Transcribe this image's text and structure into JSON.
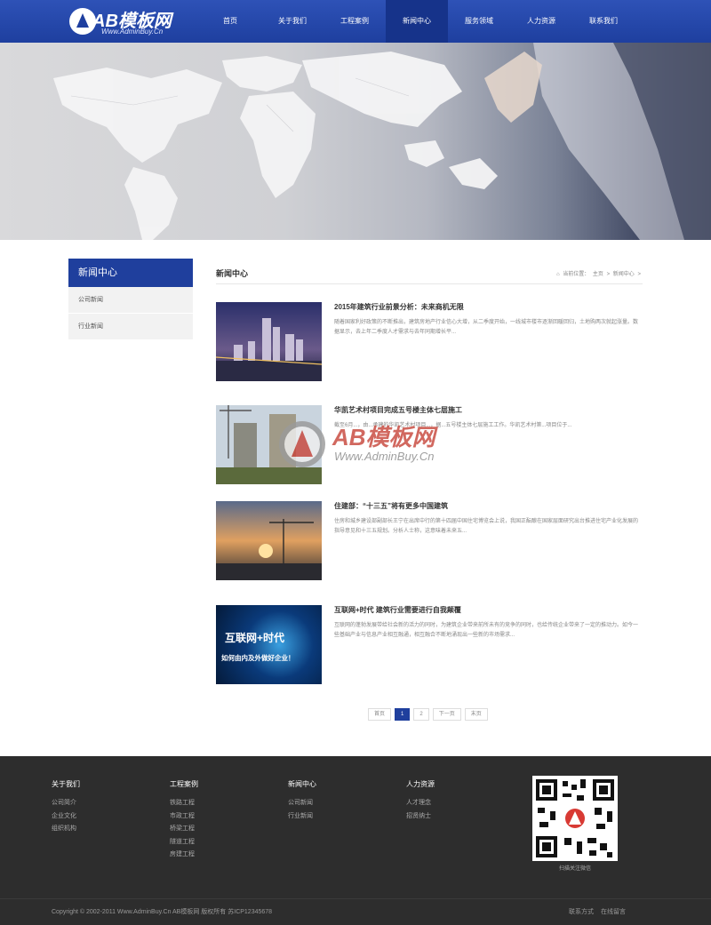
{
  "header": {
    "logo_text": "AB模板网",
    "logo_url": "Www.AdminBuy.Cn",
    "nav": [
      {
        "label": "首页"
      },
      {
        "label": "关于我们"
      },
      {
        "label": "工程案例"
      },
      {
        "label": "新闻中心",
        "active": true
      },
      {
        "label": "服务领域"
      },
      {
        "label": "人力资源"
      },
      {
        "label": "联系我们"
      }
    ]
  },
  "sidebar": {
    "title": "新闻中心",
    "items": [
      {
        "label": "公司新闻"
      },
      {
        "label": "行业新闻"
      }
    ]
  },
  "main": {
    "title": "新闻中心",
    "breadcrumb": {
      "prefix": "当前位置：",
      "home": "主页",
      "sep": ">",
      "current": "新闻中心",
      "end": ">"
    },
    "news": [
      {
        "title": "2015年建筑行业前景分析：未来商机无限",
        "desc": "随着国家利好政策的不断推出，建筑房地产行业信心大增，从二季度开始，一线城市楼市逐渐回暖回归，土地购两次就起涨量。数据显示，去上年二季度人才需求与去年同期增长平..."
      },
      {
        "title": "华凯艺术村项目完成五号楼主体七层施工",
        "desc": "截至6月...，由...承建的华凯艺术村项目...，据...五号楼主体七层施工工作。华凯艺术村第...项目位于..."
      },
      {
        "title": "住建部：“十三五”将有更多中国建筑",
        "desc": "住房和城乡建设部副部长王宁在出席中行的第十四届中国住宅博览会上说，我国正酝酿在国家层面研究出台推进住宅产业化发展的指导意见和十三五规划。分析人士称，这意味着未来五..."
      },
      {
        "title": "互联网+时代 建筑行业需要进行自我颠覆",
        "desc": "互联网的蓬勃发展带给社会新的活力的同时，为建筑企业带来前所未有的竞争的同时，也给传统企业带来了一定的推动力。如今一些基础产业与信息产业相互融通，相互融合不断地涌现出一些新的市场需求..."
      }
    ],
    "thumb4_line1": "互联网+时代",
    "thumb4_line2": "如何由内及外做好企业！",
    "pager": [
      "首页",
      "1",
      "2",
      "下一页",
      "末页"
    ]
  },
  "watermark": {
    "text": "AB模板网",
    "url": "Www.AdminBuy.Cn"
  },
  "footer": {
    "columns": [
      {
        "title": "关于我们",
        "links": [
          "公司简介",
          "企业文化",
          "组织机构"
        ]
      },
      {
        "title": "工程案例",
        "links": [
          "铁路工程",
          "市政工程",
          "桥梁工程",
          "隧道工程",
          "房建工程"
        ]
      },
      {
        "title": "新闻中心",
        "links": [
          "公司新闻",
          "行业新闻"
        ]
      },
      {
        "title": "人力资源",
        "links": [
          "人才理念",
          "招贤纳士"
        ]
      }
    ],
    "qr_caption": "扫描关注微信",
    "copyright": "Copyright © 2002-2011 Www.AdminBuy.Cn AB模板网 版权所有   苏ICP12345678",
    "links": [
      "联系方式",
      "在线留言"
    ]
  },
  "colors": {
    "brand": "#1f3f9d",
    "footer_bg": "#2d2d2d",
    "watermark": "#c8473c"
  }
}
